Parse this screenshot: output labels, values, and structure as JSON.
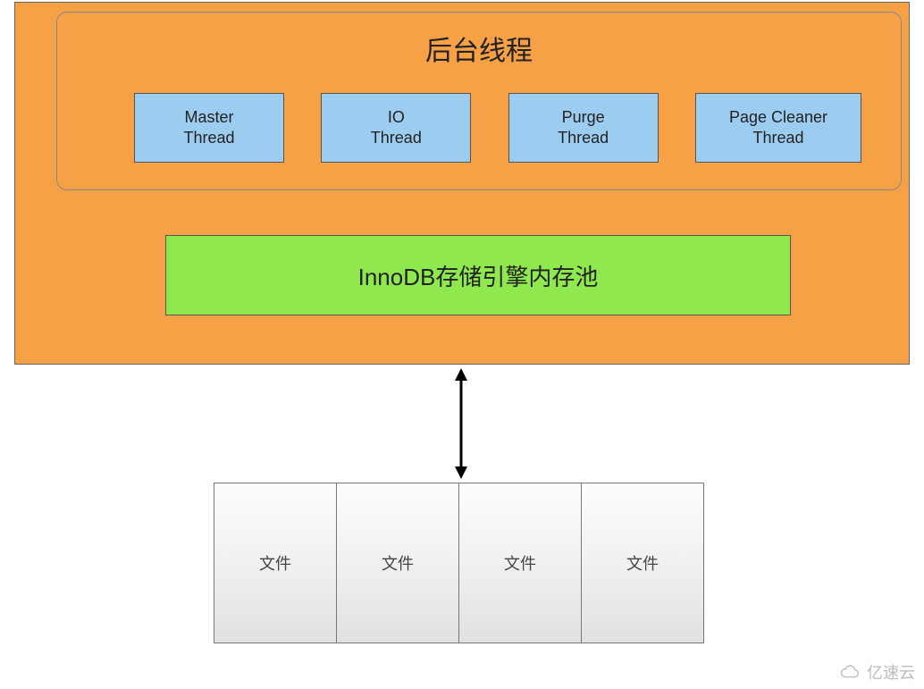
{
  "threads": {
    "title": "后台线程",
    "items": [
      {
        "line1": "Master",
        "line2": "Thread"
      },
      {
        "line1": "IO",
        "line2": "Thread"
      },
      {
        "line1": "Purge",
        "line2": "Thread"
      },
      {
        "line1": "Page Cleaner",
        "line2": "Thread"
      }
    ]
  },
  "pool_label": "InnoDB存储引擎内存池",
  "files": [
    "文件",
    "文件",
    "文件",
    "文件"
  ],
  "watermark": "亿速云",
  "colors": {
    "orange": "#f7a147",
    "blue": "#9cccf0",
    "green": "#8fe84d"
  }
}
